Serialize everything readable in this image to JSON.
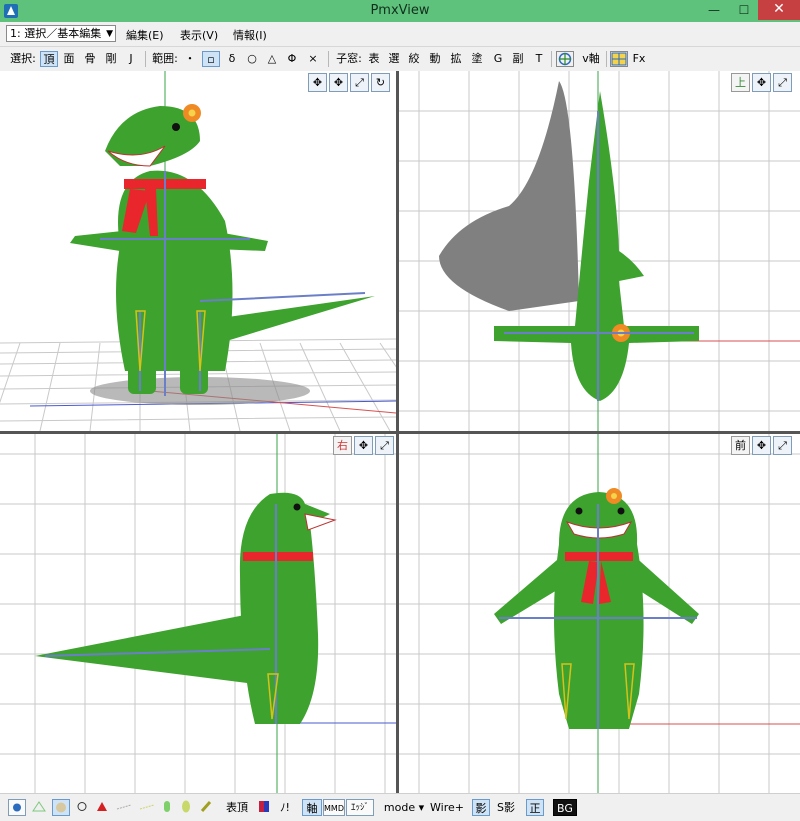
{
  "window": {
    "title": "PmxView",
    "min": "—",
    "max": "☐",
    "close": "✕"
  },
  "menubar": {
    "mode_select": "1: 選択／基本編集",
    "items": [
      "編集(E)",
      "表示(V)",
      "情報(I)"
    ]
  },
  "toolbar": {
    "select_label": "選択:",
    "select_items": [
      "頂",
      "面",
      "骨",
      "剛",
      "J"
    ],
    "range_label": "範囲:",
    "range_items": [
      "・",
      "▫",
      "δ",
      "○",
      "△",
      "Φ",
      "×"
    ],
    "child_label": "子窓:",
    "child_items": [
      "表",
      "選",
      "絞",
      "動",
      "拡",
      "塗",
      "G",
      "副",
      "T"
    ],
    "axis_label": "v軸",
    "fx_label": "Fx"
  },
  "viewports": {
    "top_label": "上",
    "right_label": "右",
    "front_label": "前"
  },
  "statusbar": {
    "vertex_label": "表頂",
    "no_label": "ﾉ!",
    "axis_label": "軸",
    "mmd_label": "MMD",
    "edge_label": "ｴｯｼﾞ",
    "mode_label": "mode ▾",
    "wire_label": "Wire+",
    "shadow_label": "影",
    "sshadow_label": "S影",
    "ortho_label": "正",
    "bg_label": "BG"
  },
  "colors": {
    "frame": "#5fc27c",
    "model_green": "#3ea22e",
    "model_dark": "#2c8a22",
    "scarf": "#e8262b",
    "bone": "#6b7fc8",
    "grid": "#c9c9c9",
    "shadow": "#777777"
  }
}
